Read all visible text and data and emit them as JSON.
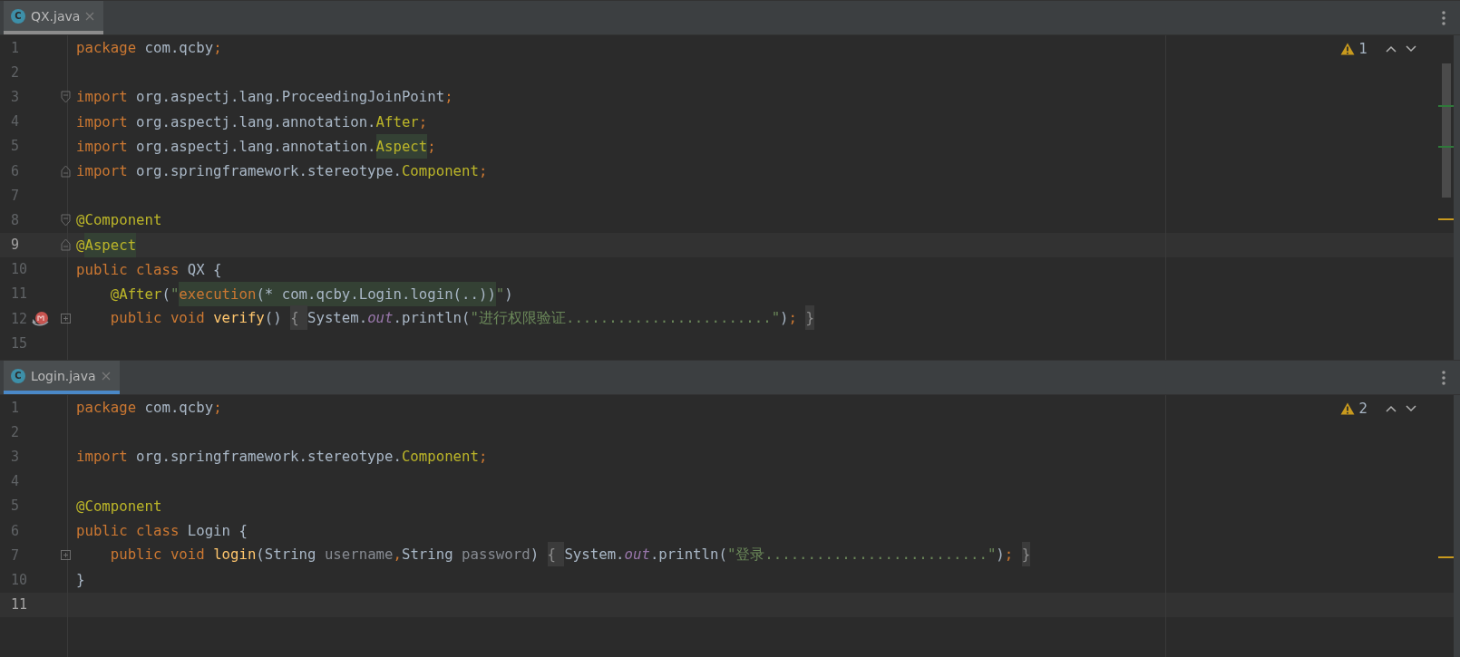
{
  "panes": [
    {
      "tab": {
        "icon_label": "C",
        "label": "QX.java",
        "selected": true
      },
      "focused": false,
      "warnings": "1",
      "lines": [
        {
          "number": "1",
          "tokens": [
            {
              "text": "package",
              "kind": "keyword"
            },
            {
              "text": " com.qcby",
              "kind": "plain"
            },
            {
              "text": ";",
              "kind": "keyword"
            }
          ]
        },
        {
          "number": "2"
        },
        {
          "number": "3",
          "kind": "fold-start",
          "tokens": [
            {
              "text": "import",
              "kind": "keyword"
            },
            {
              "text": " org.aspectj.lang.ProceedingJoinPoint",
              "kind": "plain"
            },
            {
              "text": ";",
              "kind": "keyword"
            }
          ]
        },
        {
          "number": "4",
          "tokens": [
            {
              "text": "import",
              "kind": "keyword"
            },
            {
              "text": " org.aspectj.lang.annotation.",
              "kind": "plain"
            },
            {
              "text": "After",
              "kind": "annotation"
            },
            {
              "text": ";",
              "kind": "keyword"
            }
          ]
        },
        {
          "number": "5",
          "tokens": [
            {
              "text": "import",
              "kind": "keyword"
            },
            {
              "text": " org.aspectj.lang.annotation.",
              "kind": "plain"
            },
            {
              "text": "Aspect",
              "kind": "annotation-match"
            },
            {
              "text": ";",
              "kind": "keyword"
            }
          ]
        },
        {
          "number": "6",
          "kind": "fold-end",
          "tokens": [
            {
              "text": "import",
              "kind": "keyword"
            },
            {
              "text": " org.springframework.stereotype.",
              "kind": "plain"
            },
            {
              "text": "Component",
              "kind": "annotation"
            },
            {
              "text": ";",
              "kind": "keyword"
            }
          ]
        },
        {
          "number": "7"
        },
        {
          "number": "8",
          "kind": "fold-start",
          "tokens": [
            {
              "text": "@Component",
              "kind": "annotation"
            }
          ]
        },
        {
          "number": "9",
          "kind": "fold-end",
          "current": true,
          "tokens": [
            {
              "text": "@",
              "kind": "annotation"
            },
            {
              "text": "Aspect",
              "kind": "annotation-match"
            }
          ]
        },
        {
          "number": "10",
          "tokens": [
            {
              "text": "public class",
              "kind": "keyword"
            },
            {
              "text": " QX {",
              "kind": "plain"
            }
          ]
        },
        {
          "number": "11",
          "tokens": [
            {
              "text": "    @After",
              "kind": "annotation"
            },
            {
              "text": "(",
              "kind": "plain"
            },
            {
              "text": "\"",
              "kind": "string"
            },
            {
              "text": "execution",
              "kind": "keyword-match"
            },
            {
              "text": "(* com.qcby.Login.login(..))",
              "kind": "plain-match"
            },
            {
              "text": "\"",
              "kind": "string"
            },
            {
              "text": ")",
              "kind": "plain"
            }
          ]
        },
        {
          "number": "12",
          "kind": "folded",
          "override": true,
          "tokens": [
            {
              "text": "    public void ",
              "kind": "keyword"
            },
            {
              "text": "verify",
              "kind": "declaration"
            },
            {
              "text": "() ",
              "kind": "plain"
            },
            {
              "text": "{ ",
              "kind": "folded"
            },
            {
              "text": "System.",
              "kind": "plain"
            },
            {
              "text": "out",
              "kind": "static"
            },
            {
              "text": ".println(",
              "kind": "plain"
            },
            {
              "text": "\"进行权限验证........................\"",
              "kind": "string"
            },
            {
              "text": ")",
              "kind": "plain"
            },
            {
              "text": "; ",
              "kind": "keyword"
            },
            {
              "text": "}",
              "kind": "folded"
            }
          ]
        },
        {
          "number": "15"
        }
      ]
    },
    {
      "tab": {
        "icon_label": "C",
        "label": "Login.java",
        "selected": true
      },
      "focused": true,
      "warnings": "2",
      "lines": [
        {
          "number": "1",
          "tokens": [
            {
              "text": "package",
              "kind": "keyword"
            },
            {
              "text": " com.qcby",
              "kind": "plain"
            },
            {
              "text": ";",
              "kind": "keyword"
            }
          ]
        },
        {
          "number": "2"
        },
        {
          "number": "3",
          "tokens": [
            {
              "text": "import",
              "kind": "keyword"
            },
            {
              "text": " org.springframework.stereotype.",
              "kind": "plain"
            },
            {
              "text": "Component",
              "kind": "annotation"
            },
            {
              "text": ";",
              "kind": "keyword"
            }
          ]
        },
        {
          "number": "4"
        },
        {
          "number": "5",
          "tokens": [
            {
              "text": "@Component",
              "kind": "annotation"
            }
          ]
        },
        {
          "number": "6",
          "tokens": [
            {
              "text": "public class",
              "kind": "keyword"
            },
            {
              "text": " Login {",
              "kind": "plain"
            }
          ]
        },
        {
          "number": "7",
          "kind": "folded",
          "tokens": [
            {
              "text": "    public void ",
              "kind": "keyword"
            },
            {
              "text": "login",
              "kind": "declaration"
            },
            {
              "text": "(String ",
              "kind": "plain"
            },
            {
              "text": "username",
              "kind": "parameter"
            },
            {
              "text": ",",
              "kind": "keyword"
            },
            {
              "text": "String ",
              "kind": "plain"
            },
            {
              "text": "password",
              "kind": "parameter"
            },
            {
              "text": ") ",
              "kind": "plain"
            },
            {
              "text": "{ ",
              "kind": "folded"
            },
            {
              "text": "System.",
              "kind": "plain"
            },
            {
              "text": "out",
              "kind": "static"
            },
            {
              "text": ".println(",
              "kind": "plain"
            },
            {
              "text": "\"登录..........................\"",
              "kind": "string"
            },
            {
              "text": ")",
              "kind": "plain"
            },
            {
              "text": "; ",
              "kind": "keyword"
            },
            {
              "text": "}",
              "kind": "folded"
            }
          ]
        },
        {
          "number": "10",
          "tokens": [
            {
              "text": "}",
              "kind": "plain"
            }
          ]
        },
        {
          "number": "11",
          "current": true
        }
      ]
    }
  ]
}
